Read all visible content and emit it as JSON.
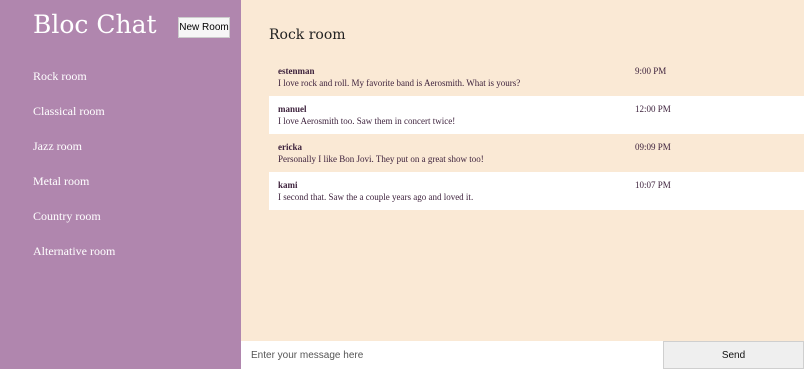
{
  "sidebar": {
    "app_title": "Bloc Chat",
    "new_room_label": "New Room",
    "rooms": [
      {
        "label": "Rock room"
      },
      {
        "label": "Classical room"
      },
      {
        "label": "Jazz room"
      },
      {
        "label": "Metal room"
      },
      {
        "label": "Country room"
      },
      {
        "label": "Alternative room"
      }
    ]
  },
  "main": {
    "room_title": "Rock room",
    "messages": [
      {
        "user": "estenman",
        "text": "I love rock and roll. My favorite band is Aerosmith. What is yours?",
        "time": "9:00 PM"
      },
      {
        "user": "manuel",
        "text": "I love Aerosmith too. Saw them in concert twice!",
        "time": "12:00 PM"
      },
      {
        "user": "ericka",
        "text": "Personally I like Bon Jovi. They put on a great show too!",
        "time": "09:09 PM"
      },
      {
        "user": "kami",
        "text": "I second that. Saw the a couple years ago and loved it.",
        "time": "10:07 PM"
      }
    ]
  },
  "composer": {
    "placeholder": "Enter your message here",
    "send_label": "Send"
  },
  "colors": {
    "sidebar_bg": "#b086ae",
    "main_bg": "#fae9d5",
    "message_alt_bg": "#ffffff",
    "text": "#3b1f3a"
  }
}
